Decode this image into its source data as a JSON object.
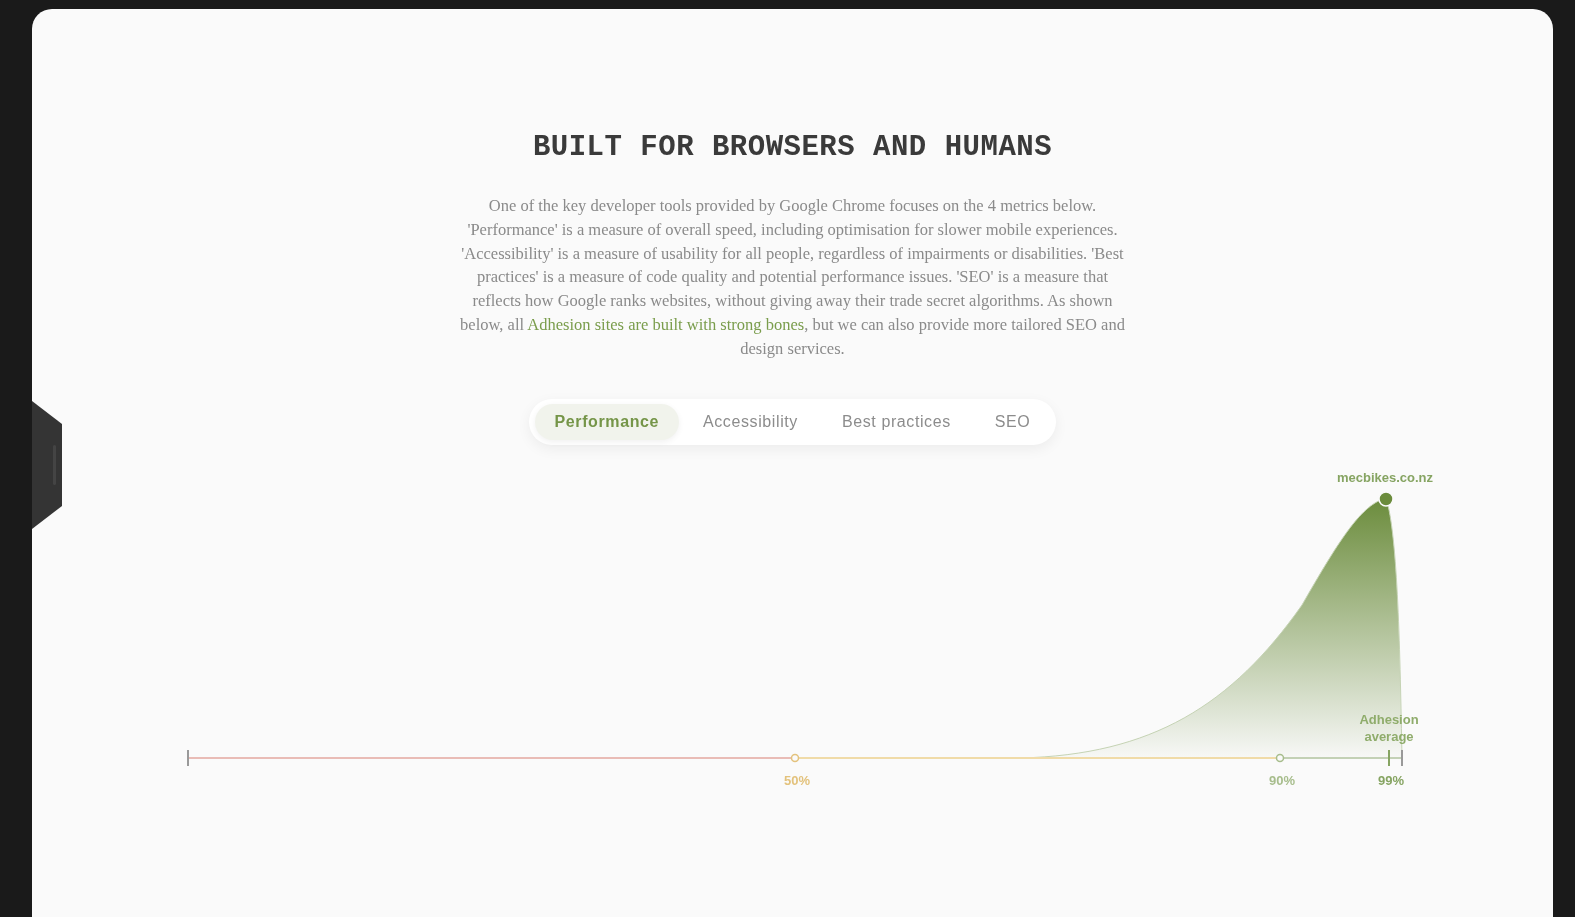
{
  "heading": "BUILT FOR BROWSERS AND HUMANS",
  "intro": {
    "before": "One of the key developer tools provided by Google Chrome focuses on the 4 metrics below. 'Performance' is a measure of overall speed, including optimisation for slower mobile experiences. 'Accessibility' is a measure of usability for all people, regardless of impairments or disabilities. 'Best practices' is a measure of code quality and potential performance issues. 'SEO' is a measure that reflects how Google ranks websites, without giving away their trade secret algorithms. As shown below, all ",
    "link": "Adhesion sites are built with strong bones",
    "after": ", but we can also provide more tailored SEO and design services."
  },
  "tabs": [
    {
      "label": "Performance",
      "selected": true
    },
    {
      "label": "Accessibility",
      "selected": false
    },
    {
      "label": "Best practices",
      "selected": false
    },
    {
      "label": "SEO",
      "selected": false
    }
  ],
  "score_chart": {
    "site_label": "mecbikes.co.nz",
    "average_label": [
      "Adhesion",
      "average"
    ],
    "marks": [
      {
        "label": "50%",
        "color": "#e3c27c"
      },
      {
        "label": "90%",
        "color": "#a7bd8c"
      },
      {
        "label": "99%",
        "color": "#86a462"
      }
    ]
  }
}
